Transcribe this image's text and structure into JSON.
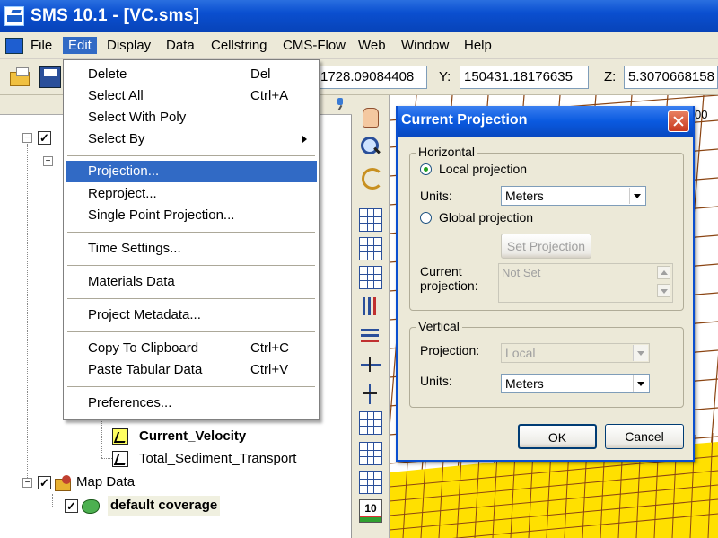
{
  "window": {
    "title": "SMS 10.1 - [VC.sms]"
  },
  "menubar": {
    "items": [
      "File",
      "Edit",
      "Display",
      "Data",
      "Cellstring",
      "CMS-Flow",
      "Web",
      "Window",
      "Help"
    ],
    "active": "Edit"
  },
  "toolbar": {
    "x_value": "1728.09084408",
    "y_label": "Y:",
    "y_value": "150431.18176635",
    "z_label": "Z:",
    "z_value": "5.3070668158"
  },
  "edit_menu": {
    "items": [
      {
        "label": "Delete",
        "shortcut": "Del"
      },
      {
        "label": "Select All",
        "shortcut": "Ctrl+A"
      },
      {
        "label": "Select With Poly",
        "shortcut": ""
      },
      {
        "label": "Select By",
        "shortcut": ""
      },
      {
        "label": "Projection...",
        "shortcut": ""
      },
      {
        "label": "Reproject...",
        "shortcut": ""
      },
      {
        "label": "Single Point Projection...",
        "shortcut": ""
      },
      {
        "label": "Time Settings...",
        "shortcut": ""
      },
      {
        "label": "Materials Data",
        "shortcut": ""
      },
      {
        "label": "Project Metadata...",
        "shortcut": ""
      },
      {
        "label": "Copy To Clipboard",
        "shortcut": "Ctrl+C"
      },
      {
        "label": "Paste Tabular Data",
        "shortcut": "Ctrl+V"
      },
      {
        "label": "Preferences...",
        "shortcut": ""
      }
    ],
    "highlighted": "Projection..."
  },
  "tree": {
    "current_velocity": "Current_Velocity",
    "total_sediment_transport": "Total_Sediment_Transport",
    "map_data": "Map Data",
    "default_coverage": "default coverage"
  },
  "canvas": {
    "partial_label": "00"
  },
  "dialog": {
    "title": "Current Projection",
    "horizontal": {
      "legend": "Horizontal",
      "local_label": "Local projection",
      "units_label": "Units:",
      "units_value": "Meters",
      "global_label": "Global projection",
      "set_projection_label": "Set Projection",
      "current_label_line1": "Current",
      "current_label_line2": "projection:",
      "current_value": "Not Set"
    },
    "vertical": {
      "legend": "Vertical",
      "projection_label": "Projection:",
      "projection_value": "Local",
      "units_label": "Units:",
      "units_value": "Meters"
    },
    "ok_label": "OK",
    "cancel_label": "Cancel"
  },
  "colors": {
    "titlebar": "#0a4fd0",
    "menu_highlight": "#316ac5",
    "dialog_bg": "#ece9d8",
    "mesh_fill": "#ffe000",
    "mesh_line": "#8b4513"
  }
}
